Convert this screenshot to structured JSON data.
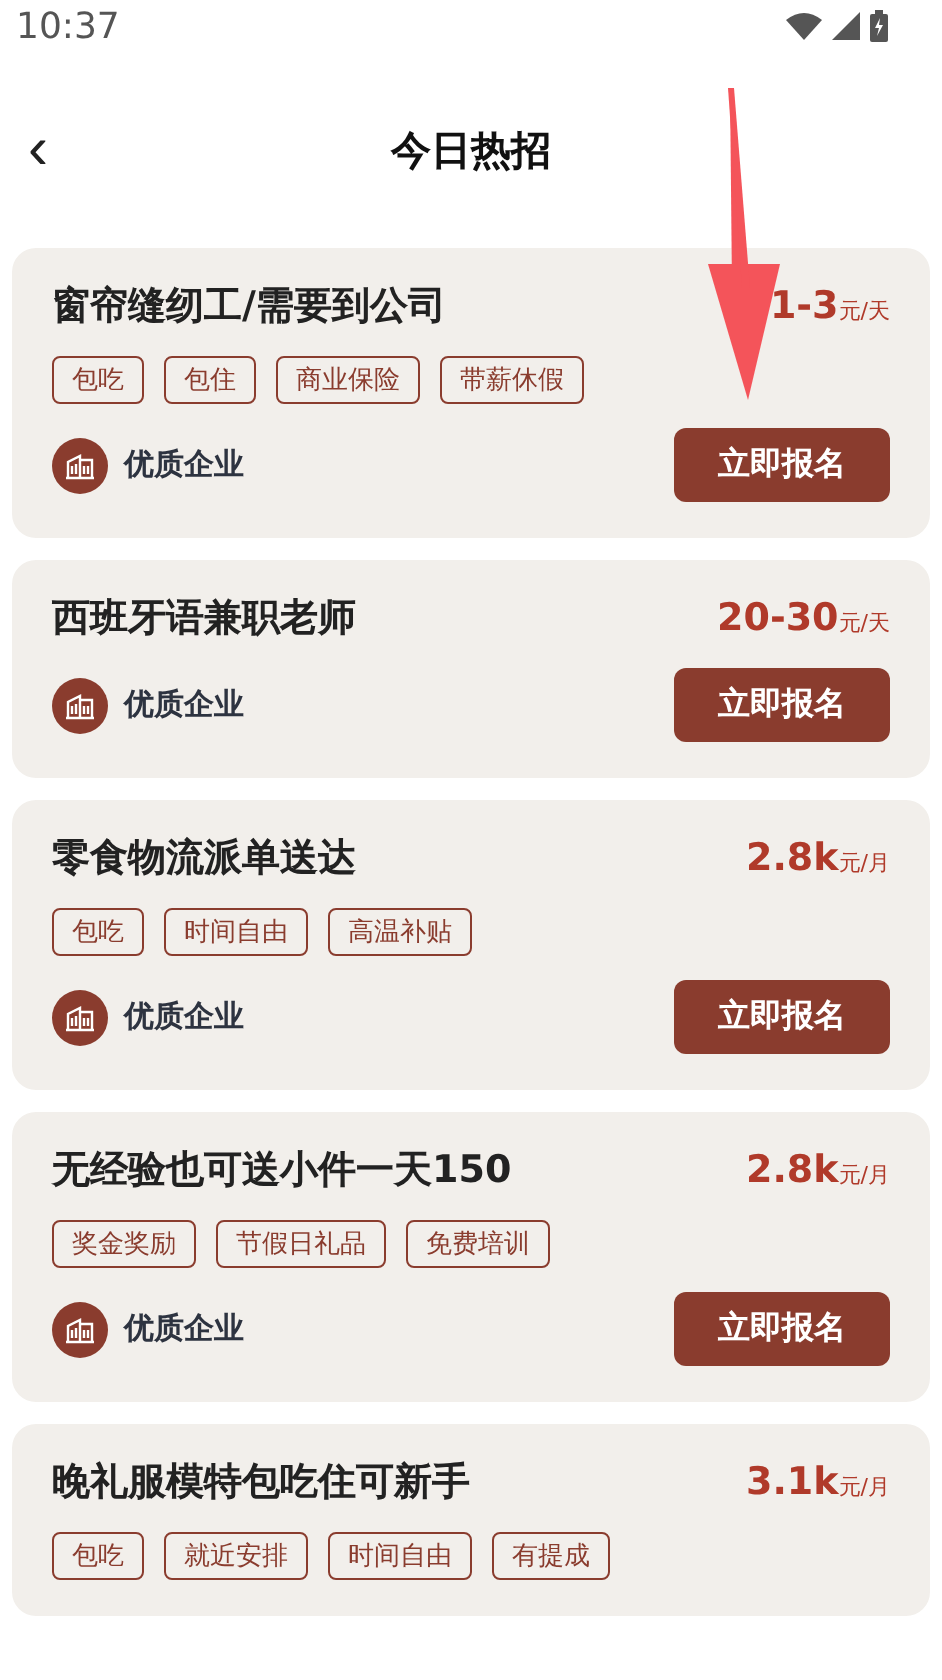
{
  "status_bar": {
    "time": "10:37"
  },
  "header": {
    "back": "‹",
    "title": "今日热招"
  },
  "jobs": [
    {
      "title": "窗帘缝纫工/需要到公司",
      "amount": "1-3",
      "unit": "元/天",
      "tags": [
        "包吃",
        "包住",
        "商业保险",
        "带薪休假"
      ],
      "company": "优质企业",
      "button": "立即报名"
    },
    {
      "title": "西班牙语兼职老师",
      "amount": "20-30",
      "unit": "元/天",
      "company": "优质企业",
      "button": "立即报名"
    },
    {
      "title": "零食物流派单送达",
      "amount": "2.8k",
      "unit": "元/月",
      "tags": [
        "包吃",
        "时间自由",
        "高温补贴"
      ],
      "company": "优质企业",
      "button": "立即报名"
    },
    {
      "title": "无经验也可送小件一天150",
      "amount": "2.8k",
      "unit": "元/月",
      "tags": [
        "奖金奖励",
        "节假日礼品",
        "免费培训"
      ],
      "company": "优质企业",
      "button": "立即报名"
    },
    {
      "title": "晚礼服模特包吃住可新手",
      "amount": "3.1k",
      "unit": "元/月",
      "tags": [
        "包吃",
        "就近安排",
        "时间自由",
        "有提成"
      ]
    }
  ]
}
